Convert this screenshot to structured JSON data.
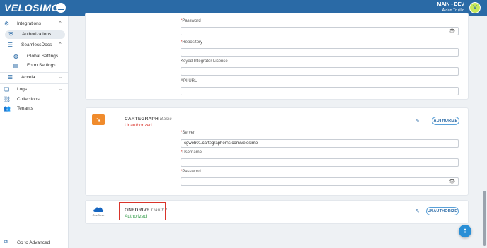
{
  "header": {
    "logo": "VELOSIMO",
    "environment": "MAIN - DEV",
    "user": "Aidan Trujillo",
    "avatar_initial": "V"
  },
  "sidebar": {
    "integrations": "Integrations",
    "authorizations": "Authorizations",
    "seamlessdocs": "SeamlessDocs",
    "global_settings": "Global Settings",
    "form_settings": "Form Settings",
    "accela": "Accela",
    "logs": "Logs",
    "collections": "Collections",
    "tenants": "Tenants",
    "go_to_advanced": "Go to Advanced"
  },
  "top_card": {
    "password_label": "Password",
    "repository_label": "Repository",
    "keyed_license_label": "Keyed Integrator License",
    "api_url_label": "API URL",
    "required_mark": "*"
  },
  "cartegraph": {
    "name": "CARTEGRAPH",
    "auth_type": "Basic",
    "status": "Unauthorized",
    "server_label": "Server",
    "server_value": "cgweb01.cartegraphoms.com/velosimo",
    "username_label": "Username",
    "password_label": "Password",
    "button": "AUTHORIZE"
  },
  "onedrive": {
    "name": "ONEDRIVE",
    "auth_type": "Oauth2",
    "status": "Authorized",
    "logo_label": "OneDrive",
    "button": "UNAUTHORIZE"
  },
  "colors": {
    "brand": "#2a6aa6",
    "error": "#d9342b",
    "success": "#2e9a44",
    "cartegraph": "#f08b2c"
  }
}
